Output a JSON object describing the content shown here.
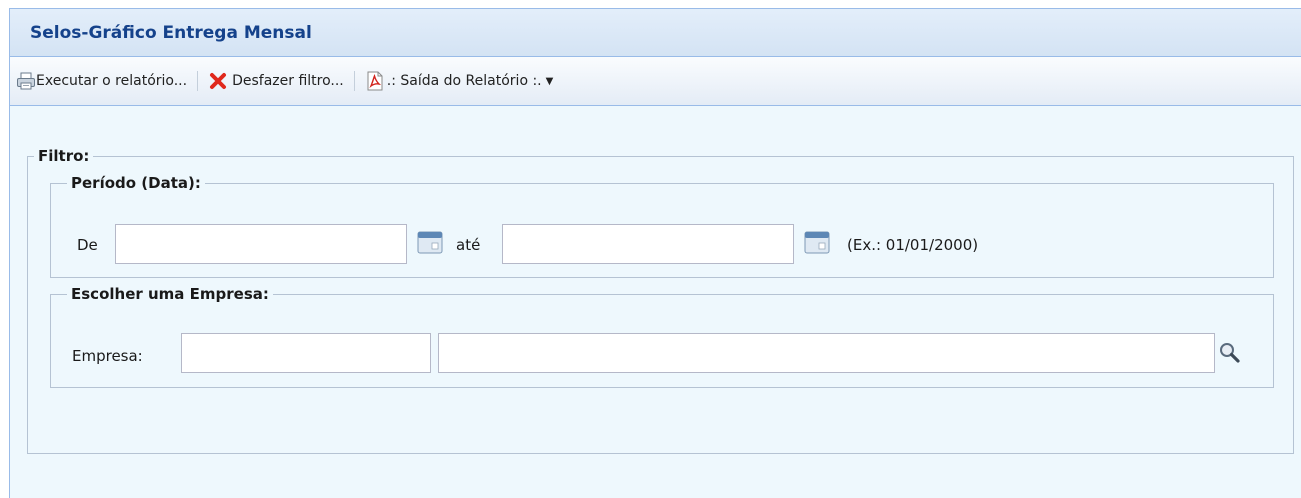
{
  "panel": {
    "title": "Selos-Gráfico Entrega Mensal"
  },
  "toolbar": {
    "run_label": "Executar o relatório...",
    "undo_filter_label": "Desfazer filtro...",
    "output_label": ".: Saída do Relatório :."
  },
  "filter": {
    "legend": "Filtro:",
    "period": {
      "legend": "Período (Data):",
      "from_label": "De",
      "from_value": "",
      "to_label": "até",
      "to_value": "",
      "example": "(Ex.: 01/01/2000)"
    },
    "company": {
      "legend": "Escolher uma Empresa:",
      "label": "Empresa:",
      "code_value": "",
      "name_value": ""
    }
  },
  "icons": {
    "print": "printer-icon",
    "undo": "red-x-icon",
    "pdf": "pdf-icon",
    "calendar": "calendar-icon",
    "search": "magnifier-icon"
  },
  "colors": {
    "title_text": "#15428b",
    "panel_background": "#eef8fd",
    "border": "#99bbe8"
  }
}
